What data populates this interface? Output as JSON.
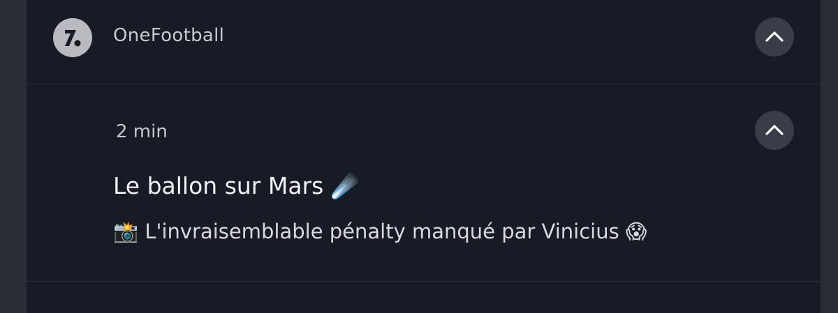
{
  "app": {
    "name": "OneFootball",
    "icon": "onefootball-logo-icon"
  },
  "notification": {
    "time": "2 min",
    "title": "Le ballon sur Mars ☄️",
    "body": "📸 L'invraisemblable pénalty manqué par Vinicius 😱"
  },
  "controls": {
    "collapse_icon": "chevron-up-icon"
  },
  "colors": {
    "panel_bg": "#171b25",
    "page_bg": "#2a2d34",
    "button_bg": "#393d47"
  }
}
